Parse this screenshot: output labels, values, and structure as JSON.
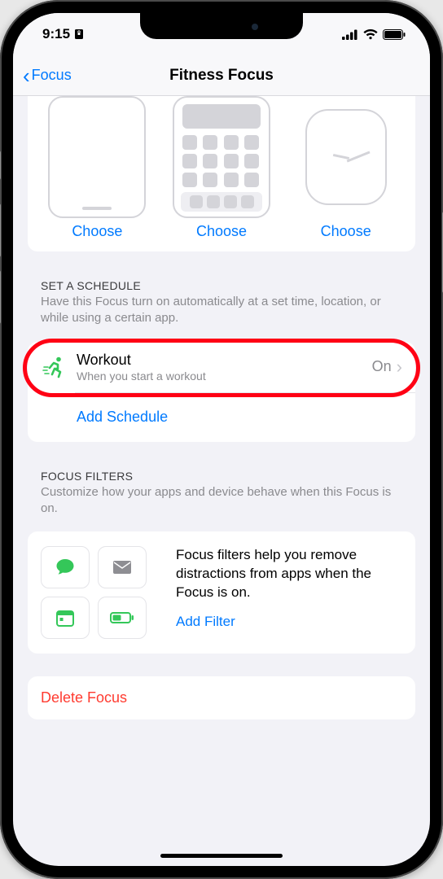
{
  "status": {
    "time": "9:15"
  },
  "nav": {
    "back_label": "Focus",
    "title": "Fitness Focus"
  },
  "screens": {
    "lock_label": "Choose",
    "home_label": "Choose",
    "watch_label": "Choose"
  },
  "schedule": {
    "section_title": "SET A SCHEDULE",
    "section_desc": "Have this Focus turn on automatically at a set time, location, or while using a certain app.",
    "workout": {
      "title": "Workout",
      "subtitle": "When you start a workout",
      "status": "On"
    },
    "add_label": "Add Schedule"
  },
  "filters": {
    "section_title": "FOCUS FILTERS",
    "section_desc": "Customize how your apps and device behave when this Focus is on.",
    "body_text": "Focus filters help you remove distractions from apps when the Focus is on.",
    "add_label": "Add Filter"
  },
  "delete": {
    "label": "Delete Focus"
  }
}
